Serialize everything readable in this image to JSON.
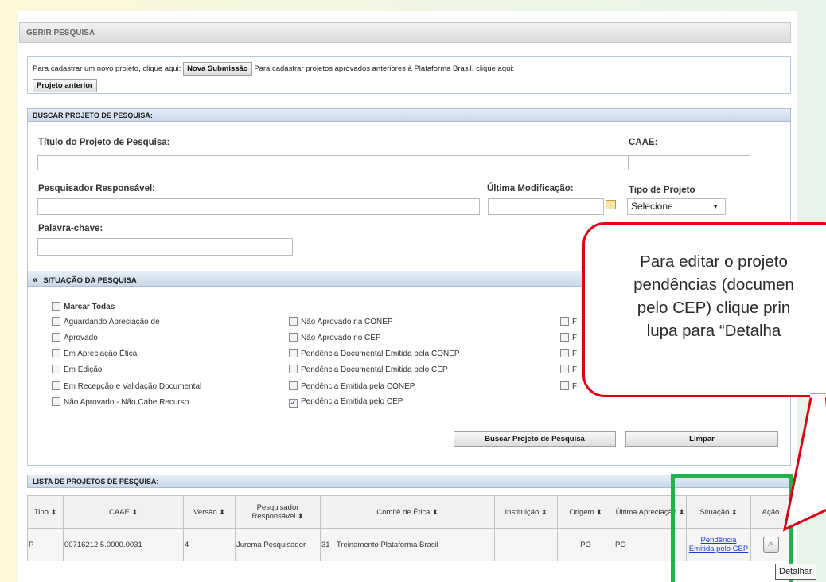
{
  "header": {
    "title": "GERIR PESQUISA"
  },
  "intro": {
    "text1": "Para cadastrar um novo projeto, clique aqui:",
    "btn_new": "Nova Submissão",
    "text2": "Para cadastrar projetos aprovados anteriores à Plataforma Brasil, clique aqui:",
    "btn_prev": "Projeto anterior"
  },
  "search": {
    "section_title": "BUSCAR PROJETO DE PESQUISA:",
    "titulo_label": "Título do Projeto de Pesquisa:",
    "caae_label": "CAAE:",
    "pesquisador_label": "Pesquisador Responsável:",
    "ultima_label": "Última Modificação:",
    "tipo_label": "Tipo de Projeto",
    "tipo_value": "Selecione",
    "palavra_label": "Palavra-chave:",
    "situacao_title": "SITUAÇÃO DA PESQUISA",
    "situacao_toggle": "«",
    "marcar": "Marcar Todas",
    "col1": [
      "Aguardando Apreciação de",
      "Aprovado",
      "Em Apreciação Ética",
      "Em Edição",
      "Em Recepção e Validação Documental",
      "Não Aprovado - Não Cabe Recurso"
    ],
    "col2": [
      "Não Aprovado na CONEP",
      "Não Aprovado no CEP",
      "Pendência Documental Emitida pela CONEP",
      "Pendência Documental Emitida pelo CEP",
      "Pendência Emitida pela CONEP",
      "Pendência Emitida pelo CEP"
    ],
    "col2_checked": [
      false,
      false,
      false,
      false,
      false,
      true
    ],
    "col3_partial": [
      "F",
      "F",
      "F",
      "F",
      "F"
    ],
    "btn_buscar": "Buscar Projeto de Pesquisa",
    "btn_limpar": "Limpar"
  },
  "list": {
    "section_title": "LISTA DE PROJETOS DE PESQUISA:",
    "headers": [
      "Tipo",
      "CAAE",
      "Versão",
      "Pesquisador Responsável",
      "Comitê de Ética",
      "Instituição",
      "Origem",
      "Última Apreciação",
      "Situação",
      "Ação"
    ],
    "row": {
      "tipo": "P",
      "caae": "00716212.5.0000.0031",
      "versao": "4",
      "pesquisador": "Jurema Pesquisador",
      "comite": "31 - Treinamento Plataforma Brasil",
      "instituicao": "",
      "origem": "PO",
      "ultima": "PO",
      "situacao": "Pendência Emitida pelo CEP"
    }
  },
  "callout": {
    "line1": "Para editar o projeto",
    "line2": "pendências (documen",
    "line3": "pelo CEP) clique prin",
    "line4": "lupa para “Detalha"
  },
  "tooltip": "Detalhar",
  "colors": {
    "callout_border": "#e3000f",
    "highlight_border": "#21b24b",
    "link": "#1a3fcf"
  }
}
